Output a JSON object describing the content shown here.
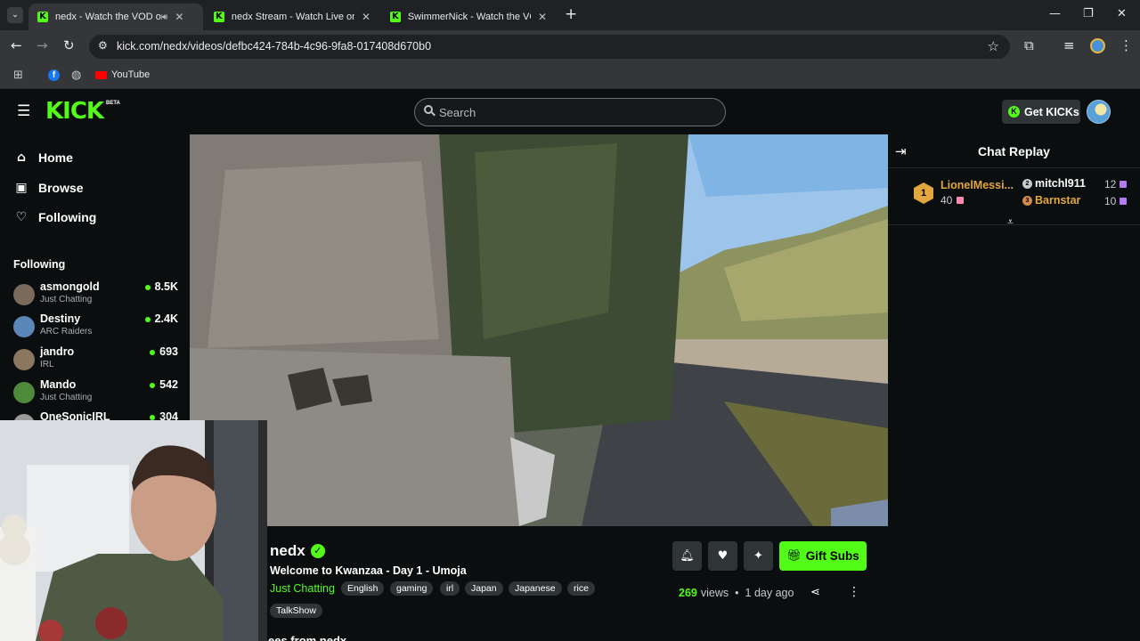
{
  "browser": {
    "tabs": [
      {
        "title": "nedx - Watch the VOD on Kick",
        "active": true
      },
      {
        "title": "nedx Stream - Watch Live on Kick",
        "active": false
      },
      {
        "title": "SwimmerNick - Watch the VOD on Kick",
        "active": false
      }
    ],
    "url": "kick.com/nedx/videos/defbc424-784b-4c96-9fa8-017408d670b0",
    "bookmarks": {
      "youtube": "YouTube"
    }
  },
  "header": {
    "logo": "KICK",
    "logo_badge": "BETA",
    "search_placeholder": "Search",
    "get_kicks_label": "Get KICKs"
  },
  "sidebar": {
    "nav": [
      {
        "label": "Home",
        "icon": "home-icon"
      },
      {
        "label": "Browse",
        "icon": "browse-icon"
      },
      {
        "label": "Following",
        "icon": "heart-icon"
      }
    ],
    "following_title": "Following",
    "following": [
      {
        "name": "asmongold",
        "category": "Just Chatting",
        "viewers": "8.5K"
      },
      {
        "name": "Destiny",
        "category": "ARC Raiders",
        "viewers": "2.4K"
      },
      {
        "name": "jandro",
        "category": "IRL",
        "viewers": "693"
      },
      {
        "name": "Mando",
        "category": "Just Chatting",
        "viewers": "542"
      },
      {
        "name": "OneSonicIRL",
        "category": "",
        "viewers": "304"
      }
    ]
  },
  "chat": {
    "title": "Chat Replay",
    "leaderboard": [
      {
        "rank": "1",
        "name": "LionelMessi...",
        "count": "40"
      },
      {
        "rank": "2",
        "name": "mitchl911",
        "count": "12"
      },
      {
        "rank": "3",
        "name": "Barnstar",
        "count": "10"
      }
    ]
  },
  "video_info": {
    "channel": "nedx",
    "title": "Welcome to Kwanzaa - Day 1 - Umoja",
    "category": "Just Chatting",
    "tags": [
      "English",
      "gaming",
      "irl",
      "Japan",
      "Japanese",
      "rice",
      "TalkShow"
    ],
    "views_count": "269",
    "views_label": "views",
    "time_ago": "1 day ago",
    "gift_subs_label": "Gift Subs",
    "section_heading": "ees from nedx"
  },
  "colors": {
    "accent": "#53fc18",
    "background": "#0b0e0f",
    "surface": "#2f3436",
    "gold": "#e2a73d"
  }
}
